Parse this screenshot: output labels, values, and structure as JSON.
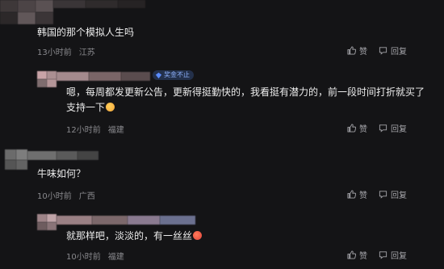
{
  "comments": [
    {
      "text": "韩国的那个模拟人生吗",
      "time": "13小时前",
      "location": "江苏",
      "like_label": "赞",
      "reply_label": "回复",
      "blur_colors": [
        "#4a4244",
        "#5a5052",
        "#3a3436",
        "#6a6062",
        "#2e2a2c",
        "#524a4c",
        "#3c3638",
        "#5e5456"
      ]
    },
    {
      "text": "嗯，每周都发更新公告，更新得挺勤快的，我看挺有潜力的，前一段时间打折就买了支持一下",
      "emoji": "hug-emoji",
      "badge": "奖金不止",
      "time": "12小时前",
      "location": "福建",
      "like_label": "赞",
      "reply_label": "回复",
      "blur_colors": [
        "#c9a2a6",
        "#a88d90",
        "#7e6c6e",
        "#5c4f51",
        "#b8999c",
        "#8d7577"
      ]
    },
    {
      "text": "牛味如何？",
      "time": "10小时前",
      "location": "广西",
      "like_label": "赞",
      "reply_label": "回复",
      "blur_colors": [
        "#6a6a6a",
        "#7a7a7a",
        "#4e4e4e",
        "#5c5c5c",
        "#6e6e6e",
        "#3e3e3e"
      ]
    },
    {
      "text": "就那样吧，淡淡的，有一丝丝",
      "emoji": "red-face-emoji",
      "time": "10小时前",
      "location": "福建",
      "like_label": "赞",
      "reply_label": "回复",
      "blur_colors": [
        "#9c8286",
        "#7d6a6d",
        "#bfa3a7",
        "#5b4d4f",
        "#8b7a8e",
        "#6a6f8c"
      ]
    }
  ],
  "colors": {
    "background": "#141416",
    "text": "#ececec",
    "meta": "#8a8a8e",
    "badge_bg": "#23304a",
    "badge_fg": "#8fb3ff",
    "emoji_orange": "#f2a33a",
    "emoji_red": "#e0443a"
  }
}
